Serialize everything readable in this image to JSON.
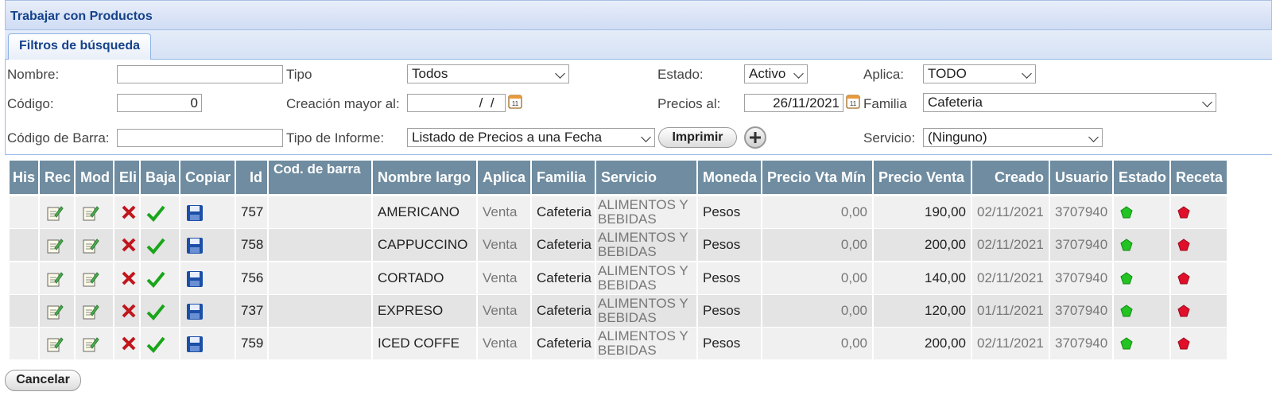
{
  "window": {
    "title": "Trabajar con Productos"
  },
  "tabs": [
    {
      "label": "Filtros de búsqueda"
    }
  ],
  "filters": {
    "nombre": {
      "label": "Nombre:",
      "value": ""
    },
    "codigo": {
      "label": "Código:",
      "value": "0"
    },
    "codigo_barra": {
      "label": "Código de Barra:",
      "value": ""
    },
    "tipo": {
      "label": "Tipo",
      "value": "Todos"
    },
    "creacion": {
      "label": "Creación mayor al:",
      "value": "  /  /  "
    },
    "tipo_informe": {
      "label": "Tipo de Informe:",
      "value": "Listado de Precios a una Fecha"
    },
    "estado": {
      "label": "Estado:",
      "value": "Activo"
    },
    "precios_al": {
      "label": "Precios al:",
      "value": "26/11/2021"
    },
    "aplica": {
      "label": "Aplica:",
      "value": "TODO"
    },
    "familia": {
      "label": "Familia",
      "value": "Cafeteria"
    },
    "servicio": {
      "label": "Servicio:",
      "value": "(Ninguno)"
    },
    "imprimir_label": "Imprimir"
  },
  "table": {
    "headers": {
      "his": "His",
      "rec": "Rec",
      "mod": "Mod",
      "eli": "Eli",
      "baja": "Baja",
      "copiar": "Copiar",
      "id": "Id",
      "cod_barra": "Cod. de barra",
      "nombre_largo": "Nombre largo",
      "aplica": "Aplica",
      "familia": "Familia",
      "servicio": "Servicio",
      "moneda": "Moneda",
      "precio_min": "Precio Vta Mín",
      "precio_venta": "Precio Venta",
      "creado": "Creado",
      "usuario": "Usuario",
      "estado": "Estado",
      "receta": "Receta"
    },
    "rows": [
      {
        "id": "757",
        "cod_barra": "",
        "nombre": "AMERICANO",
        "aplica": "Venta",
        "familia": "Cafeteria",
        "servicio": "ALIMENTOS Y BEBIDAS",
        "moneda": "Pesos",
        "precio_min": "0,00",
        "precio_venta": "190,00",
        "creado": "02/11/2021",
        "usuario": "3707940"
      },
      {
        "id": "758",
        "cod_barra": "",
        "nombre": "CAPPUCCINO",
        "aplica": "Venta",
        "familia": "Cafeteria",
        "servicio": "ALIMENTOS Y BEBIDAS",
        "moneda": "Pesos",
        "precio_min": "0,00",
        "precio_venta": "200,00",
        "creado": "02/11/2021",
        "usuario": "3707940"
      },
      {
        "id": "756",
        "cod_barra": "",
        "nombre": "CORTADO",
        "aplica": "Venta",
        "familia": "Cafeteria",
        "servicio": "ALIMENTOS Y BEBIDAS",
        "moneda": "Pesos",
        "precio_min": "0,00",
        "precio_venta": "140,00",
        "creado": "02/11/2021",
        "usuario": "3707940"
      },
      {
        "id": "737",
        "cod_barra": "",
        "nombre": "EXPRESO",
        "aplica": "Venta",
        "familia": "Cafeteria",
        "servicio": "ALIMENTOS Y BEBIDAS",
        "moneda": "Pesos",
        "precio_min": "0,00",
        "precio_venta": "120,00",
        "creado": "01/11/2021",
        "usuario": "3707940"
      },
      {
        "id": "759",
        "cod_barra": "",
        "nombre": "ICED COFFE",
        "aplica": "Venta",
        "familia": "Cafeteria",
        "servicio": "ALIMENTOS Y BEBIDAS",
        "moneda": "Pesos",
        "precio_min": "0,00",
        "precio_venta": "200,00",
        "creado": "02/11/2021",
        "usuario": "3707940"
      }
    ]
  },
  "colors": {
    "header_bg": "#6f8ca0",
    "estado_active": "#22c322",
    "receta": "#e0102a",
    "title_text": "#15428b"
  },
  "icons": {
    "rec": "edit-note-icon",
    "mod": "edit-note-icon",
    "eli": "red-x-icon",
    "baja": "green-check-icon",
    "copiar": "floppy-disk-icon",
    "estado": "green-gem-icon",
    "receta": "red-gem-icon"
  },
  "footer": {
    "cancel_label": "Cancelar"
  }
}
